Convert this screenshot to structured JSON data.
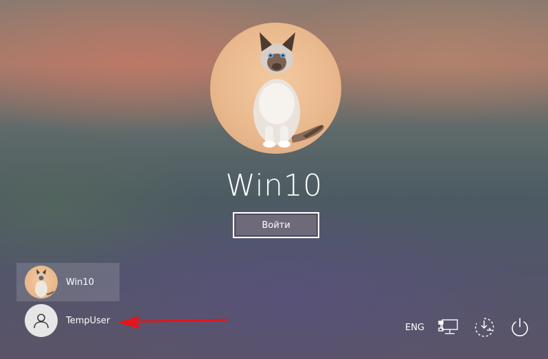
{
  "current_user": {
    "name": "Win10",
    "sign_in_label": "Войти"
  },
  "user_list": [
    {
      "name": "Win10",
      "avatar": "cat-photo",
      "selected": true
    },
    {
      "name": "TempUser",
      "avatar": "generic-user-icon",
      "selected": false
    }
  ],
  "tray": {
    "language": "ENG",
    "icons": [
      "network-icon",
      "ease-of-access-icon",
      "power-icon"
    ]
  },
  "annotation": {
    "arrow_color": "#e8141a"
  }
}
